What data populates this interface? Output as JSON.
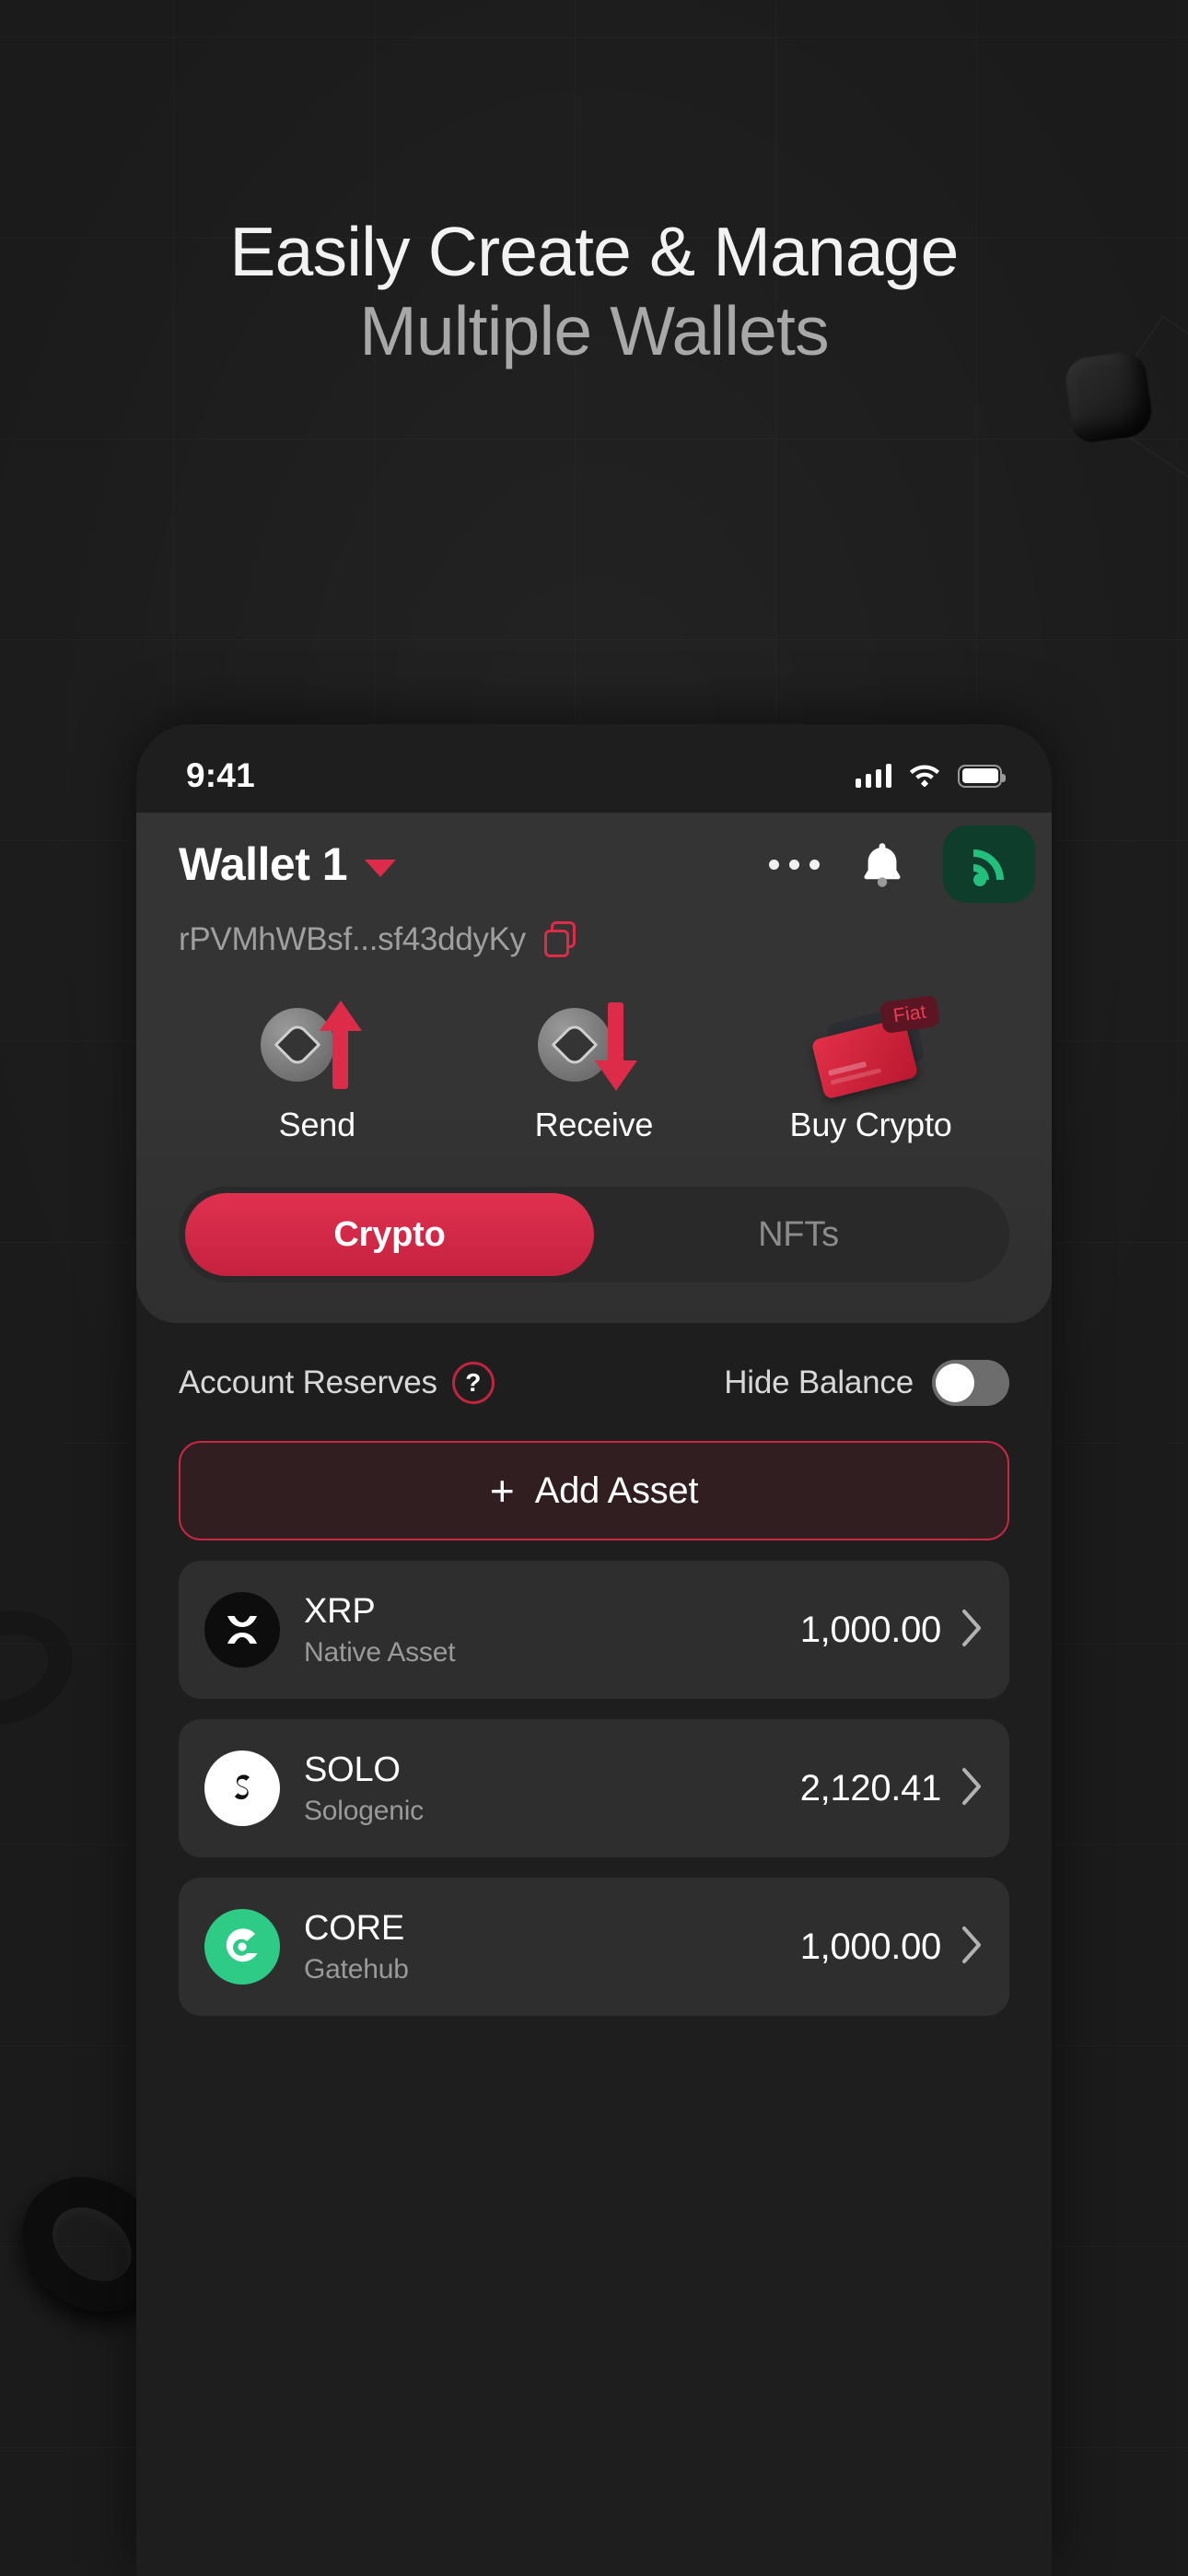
{
  "hero": {
    "line1": "Easily Create & Manage",
    "line2": "Multiple Wallets"
  },
  "colors": {
    "accent_red": "#dd2b4a",
    "accent_red_dark": "#c5223f",
    "green": "#22c07c",
    "green_dark": "#0e3d2c",
    "page_bg": "#1b1b1b",
    "phone_bg": "#1e1e1e",
    "card_bg": "#343434",
    "row_bg": "#2e2e2e"
  },
  "status_bar": {
    "time": "9:41",
    "icons": [
      "cellular-signal-icon",
      "wifi-icon",
      "battery-icon"
    ]
  },
  "header": {
    "wallet_name": "Wallet 1",
    "caret_icon": "chevron-down-icon",
    "address": "rPVMhWBsf...sf43ddyKy",
    "copy_icon": "copy-icon",
    "more_icon": "more-options-icon",
    "bell_icon": "bell-icon",
    "signal_icon": "broadcast-signal-icon"
  },
  "actions": [
    {
      "label": "Send",
      "icon": "send-coin-up-arrow-icon"
    },
    {
      "label": "Receive",
      "icon": "receive-coin-down-arrow-icon"
    },
    {
      "label": "Buy Crypto",
      "icon": "credit-card-icon",
      "badge": "Fiat"
    }
  ],
  "tabs": [
    {
      "label": "Crypto",
      "active": true
    },
    {
      "label": "NFTs",
      "active": false
    }
  ],
  "reserves": {
    "label": "Account Reserves",
    "help_icon": "question-mark-icon",
    "help_glyph": "?"
  },
  "hide_balance": {
    "label": "Hide Balance",
    "state": "off"
  },
  "add_asset": {
    "plus_glyph": "+",
    "label": "Add Asset"
  },
  "assets": [
    {
      "symbol": "XRP",
      "issuer": "Native Asset",
      "amount": "1,000.00",
      "logo_icon": "xrp-logo-icon",
      "logo_bg": "#0d0d0d",
      "logo_fg": "#ffffff",
      "chevron_icon": "chevron-right-icon"
    },
    {
      "symbol": "SOLO",
      "issuer": "Sologenic",
      "amount": "2,120.41",
      "logo_icon": "sologenic-logo-icon",
      "logo_bg": "#ffffff",
      "logo_fg": "#111111",
      "chevron_icon": "chevron-right-icon"
    },
    {
      "symbol": "CORE",
      "issuer": "Gatehub",
      "amount": "1,000.00",
      "logo_icon": "coreum-logo-icon",
      "logo_bg": "#2ecb86",
      "logo_fg": "#ffffff",
      "chevron_icon": "chevron-right-icon"
    }
  ]
}
